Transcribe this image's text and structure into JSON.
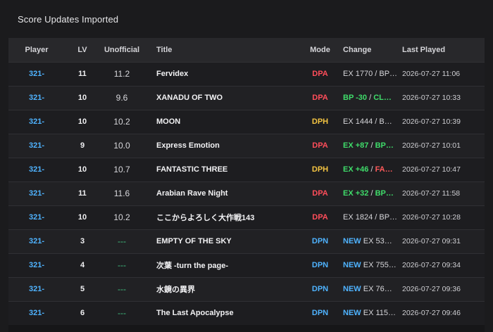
{
  "page_title": "Score Updates Imported",
  "colors": {
    "DPA": "#ff4d5a",
    "DPH": "#f5c542",
    "DPN": "#4fb3ff"
  },
  "columns": [
    "Player",
    "LV",
    "Unofficial",
    "Title",
    "Mode",
    "Change",
    "Last Played"
  ],
  "rows": [
    {
      "player": "321-",
      "lv": "11",
      "unofficial": "11.2",
      "title": "Fervidex",
      "mode": "DPA",
      "change": [
        {
          "t": "EX 1770 / BP…",
          "c": "grey"
        }
      ],
      "last_played": "2026-07-27 11:06"
    },
    {
      "player": "321-",
      "lv": "10",
      "unofficial": "9.6",
      "title": "XANADU OF TWO",
      "mode": "DPA",
      "change": [
        {
          "t": "BP -30",
          "c": "green"
        },
        {
          "t": " / ",
          "c": "grey"
        },
        {
          "t": "CL…",
          "c": "green"
        }
      ],
      "last_played": "2026-07-27 10:33"
    },
    {
      "player": "321-",
      "lv": "10",
      "unofficial": "10.2",
      "title": "MOON",
      "mode": "DPH",
      "change": [
        {
          "t": "EX 1444 / B…",
          "c": "grey"
        }
      ],
      "last_played": "2026-07-27 10:39"
    },
    {
      "player": "321-",
      "lv": "9",
      "unofficial": "10.0",
      "title": "Express Emotion",
      "mode": "DPA",
      "change": [
        {
          "t": "EX +87",
          "c": "green"
        },
        {
          "t": " / ",
          "c": "grey"
        },
        {
          "t": "BP…",
          "c": "green"
        }
      ],
      "last_played": "2026-07-27 10:01"
    },
    {
      "player": "321-",
      "lv": "10",
      "unofficial": "10.7",
      "title": "FANTASTIC THREE",
      "mode": "DPH",
      "change": [
        {
          "t": "EX +46",
          "c": "green"
        },
        {
          "t": " / ",
          "c": "grey"
        },
        {
          "t": "FA…",
          "c": "red"
        }
      ],
      "last_played": "2026-07-27 10:47"
    },
    {
      "player": "321-",
      "lv": "11",
      "unofficial": "11.6",
      "title": "Arabian Rave Night",
      "mode": "DPA",
      "change": [
        {
          "t": "EX +32",
          "c": "green"
        },
        {
          "t": " / ",
          "c": "grey"
        },
        {
          "t": "BP…",
          "c": "green"
        }
      ],
      "last_played": "2026-07-27 11:58"
    },
    {
      "player": "321-",
      "lv": "10",
      "unofficial": "10.2",
      "title": "ここからよろしく大作戦143",
      "mode": "DPA",
      "change": [
        {
          "t": "EX 1824 / BP…",
          "c": "grey"
        }
      ],
      "last_played": "2026-07-27 10:28"
    },
    {
      "player": "321-",
      "lv": "3",
      "unofficial": "---",
      "title": "EMPTY OF THE SKY",
      "mode": "DPN",
      "change": [
        {
          "t": "NEW",
          "c": "blue"
        },
        {
          "t": " EX 53…",
          "c": "grey"
        }
      ],
      "last_played": "2026-07-27 09:31"
    },
    {
      "player": "321-",
      "lv": "4",
      "unofficial": "---",
      "title": "次葉 -turn the page-",
      "mode": "DPN",
      "change": [
        {
          "t": "NEW",
          "c": "blue"
        },
        {
          "t": " EX 755…",
          "c": "grey"
        }
      ],
      "last_played": "2026-07-27 09:34"
    },
    {
      "player": "321-",
      "lv": "5",
      "unofficial": "---",
      "title": "水鏡の異界",
      "mode": "DPN",
      "change": [
        {
          "t": "NEW",
          "c": "blue"
        },
        {
          "t": " EX 76…",
          "c": "grey"
        }
      ],
      "last_played": "2026-07-27 09:36"
    },
    {
      "player": "321-",
      "lv": "6",
      "unofficial": "---",
      "title": "The Last Apocalypse",
      "mode": "DPN",
      "change": [
        {
          "t": "NEW",
          "c": "blue"
        },
        {
          "t": " EX 115…",
          "c": "grey"
        }
      ],
      "last_played": "2026-07-27 09:46"
    }
  ]
}
